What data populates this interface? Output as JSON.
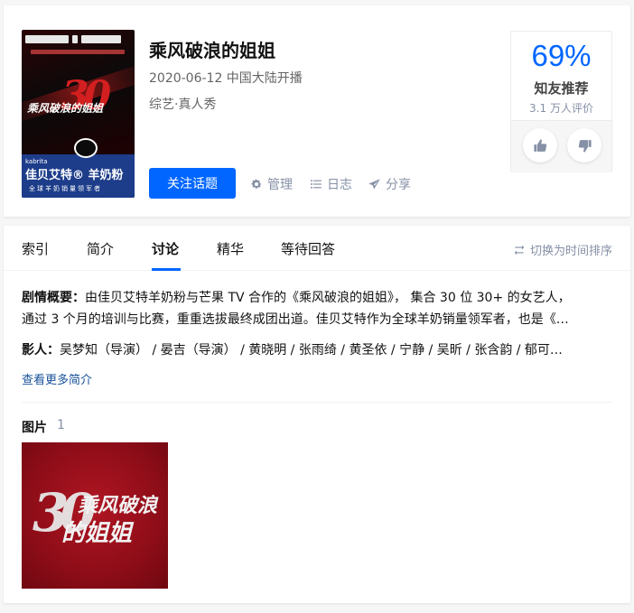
{
  "show": {
    "title": "乘风破浪的姐姐",
    "premiere": "2020-06-12 中国大陆开播",
    "genre": "综艺·真人秀"
  },
  "poster": {
    "title_text": "乘风破浪的姐姐",
    "number": "30",
    "brand_small": "kabrita",
    "brand": "佳贝艾特® 羊奶粉",
    "slogan": "全球羊奶销量领军者"
  },
  "actions": {
    "follow": "关注话题",
    "manage": "管理",
    "log": "日志",
    "share": "分享"
  },
  "rating": {
    "percent": "69%",
    "label": "知友推荐",
    "count": "3.1 万人评价"
  },
  "tabs": [
    {
      "label": "索引"
    },
    {
      "label": "简介"
    },
    {
      "label": "讨论"
    },
    {
      "label": "精华"
    },
    {
      "label": "等待回答"
    }
  ],
  "active_tab": "讨论",
  "sort_toggle": "切换为时间排序",
  "summary": {
    "label": "剧情概要：",
    "line1": "由佳贝艾特羊奶粉与芒果 TV 合作的《乘风破浪的姐姐》， 集合 30 位 30+ 的女艺人，",
    "line2": "通过 3 个月的培训与比赛，重重选拔最终成团出道。佳贝艾特作为全球羊奶销量领军者，也是《…"
  },
  "cast": {
    "label": "影人：",
    "text": "吴梦知（导演） / 晏吉（导演） / 黄晓明 / 张雨绮 / 黄圣依 / 宁静 / 吴昕 / 张含韵 / 郁可…"
  },
  "more_link": "查看更多简介",
  "pictures": {
    "title": "图片",
    "count": "1",
    "thumb_line1": "乘风破浪",
    "thumb_line2": "的姐姐",
    "thumb_number": "30"
  },
  "colors": {
    "accent": "#0066ff",
    "muted": "#8590a6",
    "link": "#175199"
  }
}
